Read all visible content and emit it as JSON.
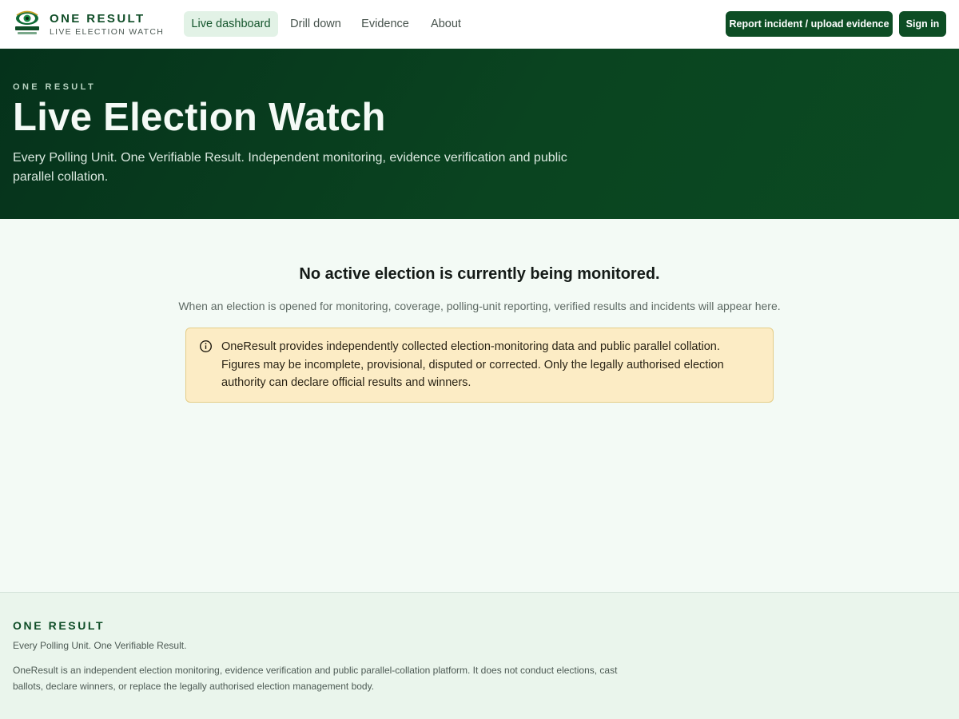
{
  "header": {
    "logo_text": "OneResult Election Watch",
    "brand_name": "ONE RESULT",
    "brand_subtitle": "LIVE ELECTION WATCH",
    "nav": [
      {
        "label": "Live dashboard",
        "active": true
      },
      {
        "label": "Drill down",
        "active": false
      },
      {
        "label": "Evidence",
        "active": false
      },
      {
        "label": "About",
        "active": false
      }
    ],
    "report_button": "Report incident / upload evidence",
    "sign_in_button": "Sign in"
  },
  "hero": {
    "eyebrow": "ONE RESULT",
    "title": "Live Election Watch",
    "description": "Every Polling Unit. One Verifiable Result. Independent monitoring, evidence verification and public parallel collation."
  },
  "main": {
    "empty_title": "No active election is currently being monitored.",
    "empty_description": "When an election is opened for monitoring, coverage, polling-unit reporting, verified results and incidents will appear here.",
    "notice": {
      "icon": "info-icon",
      "text": "OneResult provides independently collected election-monitoring data and public parallel collation. Figures may be incomplete, provisional, disputed or corrected. Only the legally authorised election authority can declare official results and winners."
    }
  },
  "footer": {
    "brand": "ONE RESULT",
    "tagline": "Every Polling Unit. One Verifiable Result.",
    "description": "OneResult is an independent election monitoring, evidence verification and public parallel-collation platform. It does not conduct elections, cast ballots, declare winners, or replace the legally authorised election management body."
  },
  "colors": {
    "brand_green": "#0d4d24",
    "hero_bg": "#05321b",
    "notice_bg": "#fcecc5",
    "page_bg": "#f3faf5",
    "footer_bg": "#eaf5ec"
  }
}
